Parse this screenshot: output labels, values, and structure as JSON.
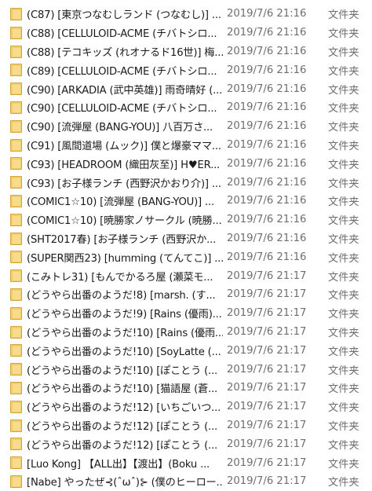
{
  "files": [
    {
      "name": "(C87) [東京つなむしランド (つなむし)] ...",
      "date": "2019/7/6 21:16",
      "type": "文件夹"
    },
    {
      "name": "(C88) [CELLULOID-ACME (チバトシロ...",
      "date": "2019/7/6 21:16",
      "type": "文件夹"
    },
    {
      "name": "(C88) [テコキッズ (れオナるド16世)] 梅...",
      "date": "2019/7/6 21:16",
      "type": "文件夹"
    },
    {
      "name": "(C89) [CELLULOID-ACME (チバトシロ...",
      "date": "2019/7/6 21:16",
      "type": "文件夹"
    },
    {
      "name": "(C90) [ARKADIA (武中英雄)] 雨奇晴好 (...",
      "date": "2019/7/6 21:16",
      "type": "文件夹"
    },
    {
      "name": "(C90) [CELLULOID-ACME (チバトシロ...",
      "date": "2019/7/6 21:16",
      "type": "文件夹"
    },
    {
      "name": "(C90) [流弾屋 (BANG-YOU)] 八百万さ...",
      "date": "2019/7/6 21:16",
      "type": "文件夹"
    },
    {
      "name": "(C91) [風間道場 (ムック)] 僕と爆豪ママ...",
      "date": "2019/7/6 21:16",
      "type": "文件夹"
    },
    {
      "name": "(C93) [HEADROOM (織田灰至)] H♥ER...",
      "date": "2019/7/6 21:16",
      "type": "文件夹"
    },
    {
      "name": "(C93) [お子様ランチ (西野沢かおり介)] ...",
      "date": "2019/7/6 21:16",
      "type": "文件夹"
    },
    {
      "name": "(COMIC1☆10) [流弾屋 (BANG-YOU)] ...",
      "date": "2019/7/6 21:16",
      "type": "文件夹"
    },
    {
      "name": "(COMIC1☆10) [暁勝家ノサークル (暁勝...",
      "date": "2019/7/6 21:16",
      "type": "文件夹"
    },
    {
      "name": "(SHT2017春) [お子様ランチ (西野沢か...",
      "date": "2019/7/6 21:16",
      "type": "文件夹"
    },
    {
      "name": "(SUPER関西23) [humming (てんてこ)] ...",
      "date": "2019/7/6 21:16",
      "type": "文件夹"
    },
    {
      "name": "(こみトレ31) [もんでかるろ屋 (瀬菜モ...",
      "date": "2019/7/6 21:17",
      "type": "文件夹"
    },
    {
      "name": "(どうやら出番のようだ!8) [marsh. (す...",
      "date": "2019/7/6 21:17",
      "type": "文件夹"
    },
    {
      "name": "(どうやら出番のようだ!9) [Rains (優雨)...",
      "date": "2019/7/6 21:17",
      "type": "文件夹"
    },
    {
      "name": "(どうやら出番のようだ!10) [Rains (優雨...",
      "date": "2019/7/6 21:17",
      "type": "文件夹"
    },
    {
      "name": "(どうやら出番のようだ!10) [SoyLatte (...",
      "date": "2019/7/6 21:17",
      "type": "文件夹"
    },
    {
      "name": "(どうやら出番のようだ!10) [ぽことう (...",
      "date": "2019/7/6 21:17",
      "type": "文件夹"
    },
    {
      "name": "(どうやら出番のようだ!10) [猫語屋 (蒼...",
      "date": "2019/7/6 21:17",
      "type": "文件夹"
    },
    {
      "name": "(どうやら出番のようだ!12) [いちごいつ...",
      "date": "2019/7/6 21:17",
      "type": "文件夹"
    },
    {
      "name": "(どうやら出番のようだ!12) [ぽことう (...",
      "date": "2019/7/6 21:17",
      "type": "文件夹"
    },
    {
      "name": "(どうやら出番のようだ!12) [ぽことう (...",
      "date": "2019/7/6 21:17",
      "type": "文件夹"
    },
    {
      "name": "[Luo Kong] 【ALL出】【渡出】(Boku ...",
      "date": "2019/7/6 21:17",
      "type": "文件夹"
    },
    {
      "name": "[Nabe] やったぜ⊰(ˆωˆ)⊱ (僕のヒーロー...",
      "date": "2019/7/6 21:17",
      "type": "文件夹"
    }
  ]
}
